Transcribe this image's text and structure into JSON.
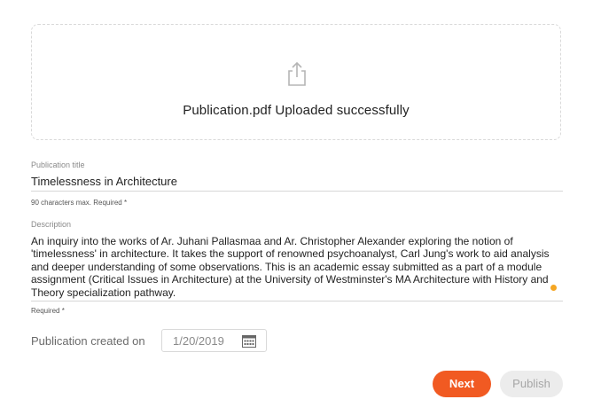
{
  "upload": {
    "message": "Publication.pdf Uploaded successfully"
  },
  "title_field": {
    "label": "Publication title",
    "value": "Timelessness in Architecture",
    "helper": "90 characters max. Required *"
  },
  "description_field": {
    "label": "Description",
    "value": "An inquiry into the works of Ar. Juhani Pallasmaa and Ar. Christopher Alexander exploring the notion of 'timelessness' in architecture. It takes the support of renowned psychoanalyst, Carl Jung's work to aid analysis and deeper understanding of some observations. This is an academic essay submitted as a part of a module assignment (Critical Issues in Architecture) at the University of Westminster's MA Architecture with History and Theory specialization pathway.",
    "helper": "Required *"
  },
  "date_field": {
    "label": "Publication created on",
    "value": "1/20/2019"
  },
  "actions": {
    "next_label": "Next",
    "publish_label": "Publish"
  },
  "colors": {
    "accent": "#f15a22",
    "indicator": "#f5a623",
    "disabled_bg": "#ececec"
  },
  "icons": {
    "upload": "share-upload-icon",
    "calendar": "calendar-icon"
  }
}
